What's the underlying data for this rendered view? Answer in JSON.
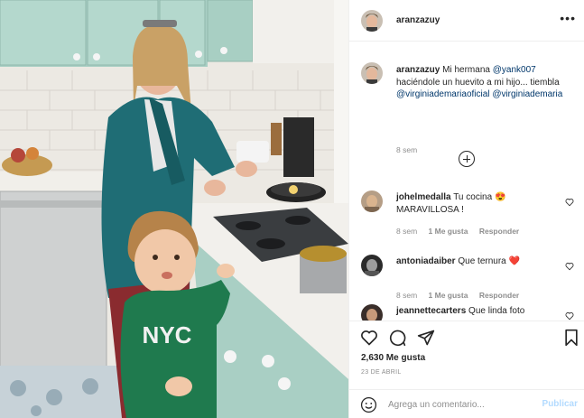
{
  "post": {
    "username": "aranzazuy",
    "more_icon": "more-horizontal-icon",
    "caption": {
      "username": "aranzazuy",
      "text_1": "Mi hermana",
      "mention_1": "@yank007",
      "text_2": "haciéndole un huevito a mi hijo... tiembla",
      "mention_2": "@virginiademariaoficial",
      "mention_3": "@virginiademaria",
      "time": "8 sem"
    },
    "load_more_icon": "plus-circle-icon",
    "comments": [
      {
        "username": "johelmedalla",
        "text": "Tu cocina",
        "emoji": "😍",
        "text_after": "MARAVILLOSA !",
        "time": "8 sem",
        "likes": "1 Me gusta",
        "reply": "Responder"
      },
      {
        "username": "antoniadaiber",
        "text": "Que ternura",
        "emoji": "❤️",
        "text_after": "",
        "time": "8 sem",
        "likes": "1 Me gusta",
        "reply": "Responder"
      },
      {
        "username": "jeannettecarters",
        "text": "Que linda foto",
        "emoji": "",
        "text_after": "",
        "time": "",
        "likes": "",
        "reply": ""
      }
    ],
    "likes": "2,630 Me gusta",
    "date": "23 DE ABRIL",
    "add_comment_placeholder": "Agrega un comentario...",
    "publish_label": "Publicar"
  },
  "colors": {
    "link": "#00376b",
    "muted": "#8e8e8e",
    "publish_disabled": "#b3dbff",
    "heart_red": "#ed4956"
  }
}
